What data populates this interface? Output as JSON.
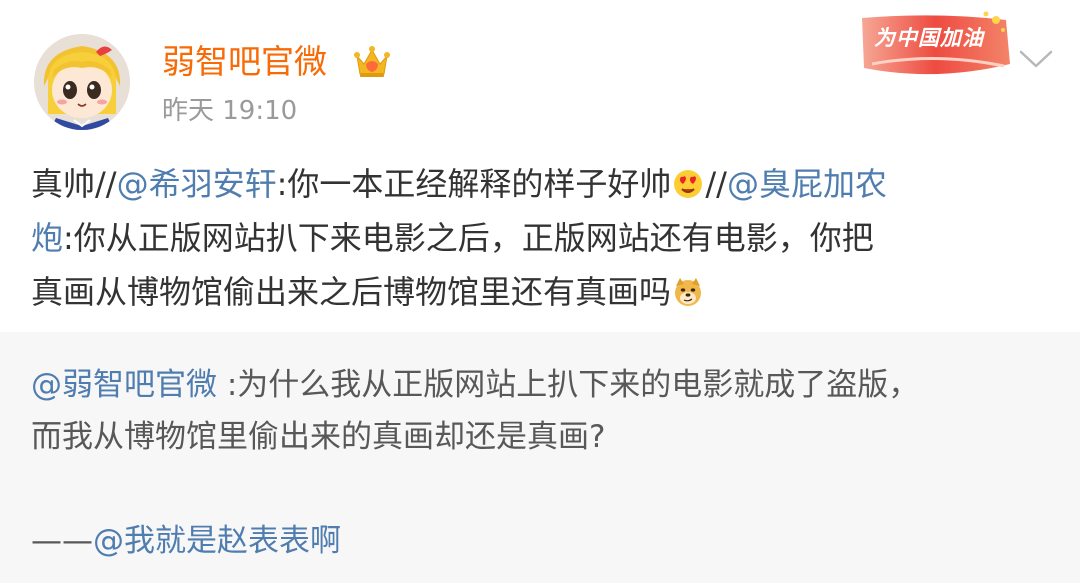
{
  "post": {
    "username": "弱智吧官微",
    "time": "昨天 19:10",
    "badge": "为中国加油",
    "content": {
      "line1": {
        "prefix": "真帅//",
        "mention1": "@希羽安轩",
        "text1": ":你一本正经解释的样子好帅",
        "emoji1": "heart-eyes-emoji",
        "sep": "//",
        "mention2_part1": "@臭屁加农"
      },
      "line2": {
        "mention2_part2": "炮",
        "text": ":你从正版网站扒下来电影之后，正版网站还有电影，你把"
      },
      "line3": {
        "text": "真画从博物馆偷出来之后博物馆里还有真画吗",
        "emoji": "doge-emoji"
      }
    }
  },
  "repost": {
    "mention": "@弱智吧官微",
    "line1_text": " :为什么我从正版网站上扒下来的电影就成了盗版，",
    "line2_text": "而我从博物馆里偷出来的真画却还是真画?",
    "sig_dash": "——",
    "sig_mention": "@我就是赵表表啊"
  },
  "colors": {
    "username": "#f86a06",
    "mention": "#507daf",
    "repost_bg": "#f7f7f7",
    "badge": "#e8332b"
  }
}
